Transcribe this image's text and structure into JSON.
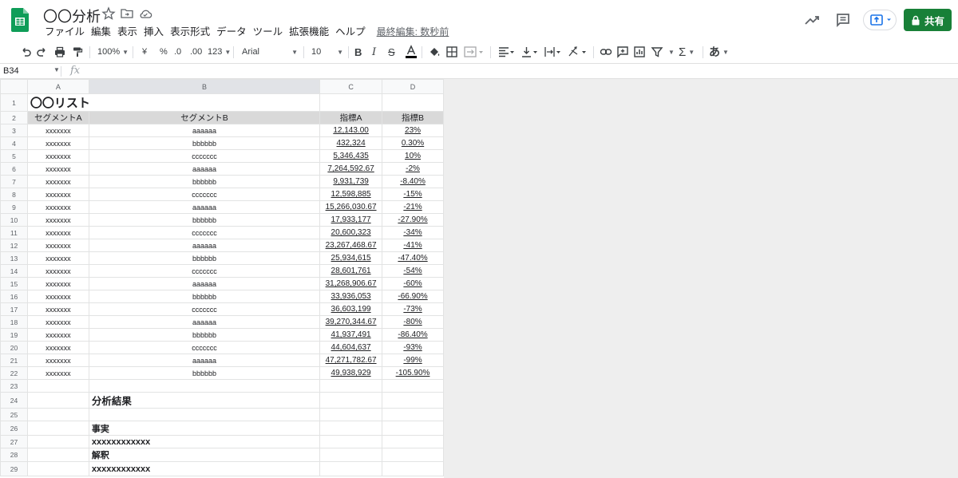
{
  "doc": {
    "title": "〇〇分析",
    "menus": [
      "ファイル",
      "編集",
      "表示",
      "挿入",
      "表示形式",
      "データ",
      "ツール",
      "拡張機能",
      "ヘルプ"
    ],
    "last_edit": "最終編集: 数秒前",
    "share_label": "共有"
  },
  "toolbar": {
    "zoom": "100%",
    "currency": "¥",
    "percent": "%",
    "dec_decrease": ".0",
    "dec_increase": ".00",
    "more_formats": "123",
    "font": "Arial",
    "font_size": "10",
    "input_tools": "あ"
  },
  "formula_bar": {
    "name_box": "B34",
    "fx": "fx"
  },
  "columns": [
    "A",
    "B",
    "C",
    "D"
  ],
  "sheet": {
    "title": "〇〇リスト",
    "headers": [
      "セグメントA",
      "セグメントB",
      "指標A",
      "指標B"
    ],
    "rows": [
      [
        "xxxxxxx",
        "aaaaaa",
        "12,143.00",
        "23%"
      ],
      [
        "xxxxxxx",
        "bbbbbb",
        "432,324",
        "0.30%"
      ],
      [
        "xxxxxxx",
        "ccccccc",
        "5,346,435",
        "10%"
      ],
      [
        "xxxxxxx",
        "aaaaaa",
        "7,264,592.67",
        "-2%"
      ],
      [
        "xxxxxxx",
        "bbbbbb",
        "9,931,739",
        "-8.40%"
      ],
      [
        "xxxxxxx",
        "ccccccc",
        "12,598,885",
        "-15%"
      ],
      [
        "xxxxxxx",
        "aaaaaa",
        "15,266,030.67",
        "-21%"
      ],
      [
        "xxxxxxx",
        "bbbbbb",
        "17,933,177",
        "-27.90%"
      ],
      [
        "xxxxxxx",
        "ccccccc",
        "20,600,323",
        "-34%"
      ],
      [
        "xxxxxxx",
        "aaaaaa",
        "23,267,468.67",
        "-41%"
      ],
      [
        "xxxxxxx",
        "bbbbbb",
        "25,934,615",
        "-47.40%"
      ],
      [
        "xxxxxxx",
        "ccccccc",
        "28,601,761",
        "-54%"
      ],
      [
        "xxxxxxx",
        "aaaaaa",
        "31,268,906.67",
        "-60%"
      ],
      [
        "xxxxxxx",
        "bbbbbb",
        "33,936,053",
        "-66.90%"
      ],
      [
        "xxxxxxx",
        "ccccccc",
        "36,603,199",
        "-73%"
      ],
      [
        "xxxxxxx",
        "aaaaaa",
        "39,270,344.67",
        "-80%"
      ],
      [
        "xxxxxxx",
        "bbbbbb",
        "41,937,491",
        "-86.40%"
      ],
      [
        "xxxxxxx",
        "ccccccc",
        "44,604,637",
        "-93%"
      ],
      [
        "xxxxxxx",
        "aaaaaa",
        "47,271,782.67",
        "-99%"
      ],
      [
        "xxxxxxx",
        "bbbbbb",
        "49,938,929",
        "-105.90%"
      ]
    ],
    "analysis_heading": "分析結果",
    "fact_label": "事実",
    "fact_value": "xxxxxxxxxxxx",
    "interp_label": "解釈",
    "interp_value": "xxxxxxxxxxxx"
  },
  "colors": {
    "share": "#188038",
    "header_fill": "#d9d9d9",
    "logo": "#0f9d58"
  }
}
